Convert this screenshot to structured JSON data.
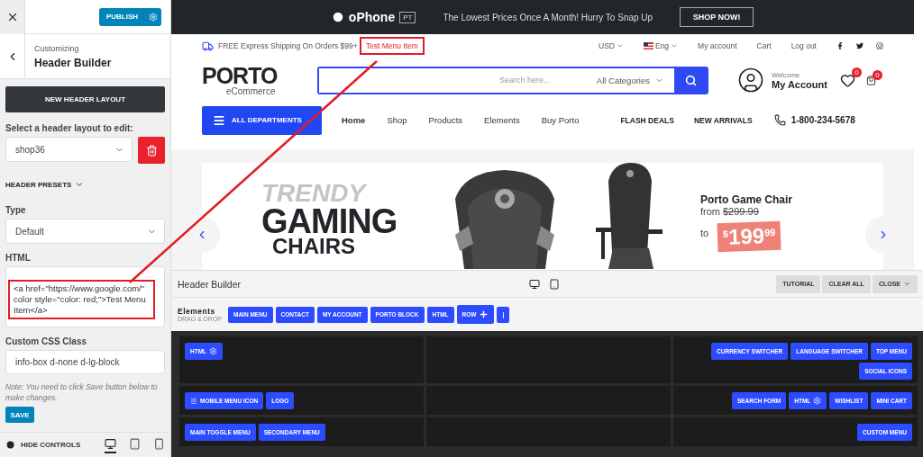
{
  "sidebar": {
    "publish": "PUBLISH",
    "customizing": "Customizing",
    "title": "Header Builder",
    "new_layout": "NEW HEADER LAYOUT",
    "layout_label": "Select a header layout to edit:",
    "layout_value": "shop36",
    "presets": "HEADER PRESETS",
    "type_label": "Type",
    "type_value": "Default",
    "html_label": "HTML",
    "html_value": "<a href=\"https://www.google.com/\" color  style=\"color: red;\">Test Menu Item</a>",
    "css_label": "Custom CSS Class",
    "css_value": "info-box d-none d-lg-block",
    "note": "Note: You need to click Save button below to make changes.",
    "save": "SAVE",
    "hide_controls": "HIDE CONTROLS",
    "devices": [
      {
        "kind": "desktop",
        "selected": true
      },
      {
        "kind": "tablet",
        "selected": false
      },
      {
        "kind": "mobile",
        "selected": false
      }
    ]
  },
  "promo": {
    "brand": "oPhone",
    "badge": "PT",
    "text": "The Lowest Prices Once A Month! Hurry To Snap Up",
    "button": "SHOP NOW!"
  },
  "info_bar": {
    "shipping": "FREE Express Shipping On Orders $99+",
    "link": "Test Menu Item",
    "currency": "USD",
    "language": "Eng",
    "links": [
      "My account",
      "Cart",
      "Log out"
    ]
  },
  "header": {
    "logo": "PORTO",
    "logo_sub": "eCommerce",
    "search_placeholder": "Search here...",
    "category": "All Categories",
    "welcome": "Welcome",
    "account": "My Account",
    "wishlist_count": "0",
    "cart_count": "0"
  },
  "nav": {
    "departments": "ALL DEPARTMENTS",
    "links": [
      "Home",
      "Shop",
      "Products",
      "Elements",
      "Buy Porto"
    ],
    "promo_links": [
      "FLASH DEALS",
      "NEW ARRIVALS"
    ],
    "phone": "1-800-234-5678"
  },
  "banner": {
    "kicker": "TRENDY",
    "title_1": "GAMING",
    "title_2": "CHAIRS",
    "product": "Porto Game Chair",
    "from_label": "from",
    "old_price": "$299.99",
    "to_label": "to",
    "price_currency": "$",
    "price_whole": "199",
    "price_cents": "99"
  },
  "builder": {
    "title": "Header Builder",
    "buttons": [
      "TUTORIAL",
      "CLEAR ALL",
      "CLOSE"
    ],
    "elements_label": "Elements",
    "elements_hint": "DRAG & DROP",
    "elements": [
      {
        "label": "MAIN MENU",
        "kind": "plain"
      },
      {
        "label": "CONTACT",
        "kind": "plain"
      },
      {
        "label": "MY ACCOUNT",
        "kind": "plain"
      },
      {
        "label": "PORTO BLOCK",
        "kind": "plain"
      },
      {
        "label": "HTML",
        "kind": "plain"
      },
      {
        "label": "ROW",
        "kind": "row"
      },
      {
        "label": "|",
        "kind": "plain"
      }
    ],
    "rows": [
      {
        "left": [
          {
            "label": "HTML",
            "kind": "settings"
          }
        ],
        "center": [],
        "right": [
          {
            "label": "CURRENCY SWITCHER",
            "kind": "plain"
          },
          {
            "label": "LANGUAGE SWITCHER",
            "kind": "plain"
          },
          {
            "label": "TOP MENU",
            "kind": "plain"
          },
          {
            "label": "SOCIAL ICONS",
            "kind": "plain"
          }
        ]
      },
      {
        "left": [
          {
            "label": "MOBILE MENU ICON",
            "kind": "menu"
          },
          {
            "label": "LOGO",
            "kind": "plain"
          }
        ],
        "center": [],
        "right": [
          {
            "label": "SEARCH FORM",
            "kind": "plain"
          },
          {
            "label": "HTML",
            "kind": "settings"
          },
          {
            "label": "WISHLIST",
            "kind": "plain"
          },
          {
            "label": "MINI CART",
            "kind": "plain"
          }
        ]
      },
      {
        "left": [
          {
            "label": "MAIN TOGGLE MENU",
            "kind": "plain"
          },
          {
            "label": "SECONDARY MENU",
            "kind": "plain"
          }
        ],
        "center": [],
        "right": [
          {
            "label": "CUSTOM MENU",
            "kind": "plain"
          }
        ]
      }
    ]
  }
}
